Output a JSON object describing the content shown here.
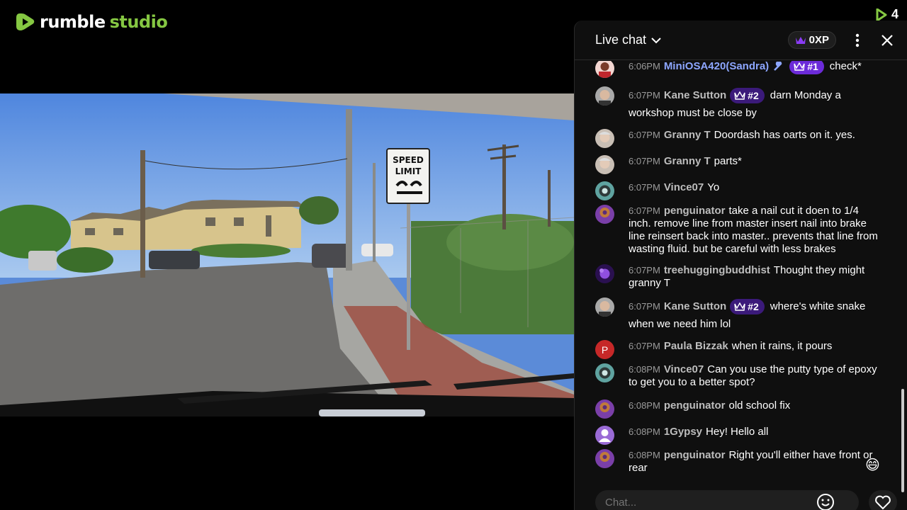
{
  "brand": {
    "name_part1": "rumble",
    "name_part2": "studio",
    "accent": "#85c742"
  },
  "viewers": {
    "count": "4"
  },
  "chat": {
    "title": "Live chat",
    "xp_label": "0XP",
    "input_placeholder": "Chat...",
    "messages": [
      {
        "time": "6:06PM",
        "user": "MiniOSA420(Sandra)",
        "badge": "#1",
        "text": "check*"
      },
      {
        "time": "6:07PM",
        "user": "Kane Sutton",
        "badge": "#2",
        "text": "darn Monday a workshop must be close by"
      },
      {
        "time": "6:07PM",
        "user": "Granny T",
        "text": "Doordash has oarts on it. yes."
      },
      {
        "time": "6:07PM",
        "user": "Granny T",
        "text": "parts*"
      },
      {
        "time": "6:07PM",
        "user": "Vince07",
        "text": "Yo"
      },
      {
        "time": "6:07PM",
        "user": "penguinator",
        "text": "take a nail cut it doen to 1/4 inch. remove line from master insert nail into brake line reinsert back into master.. prevents that line from wasting fluid. but be careful with less brakes"
      },
      {
        "time": "6:07PM",
        "user": "treehuggingbuddhist",
        "text": "Thought they might granny T"
      },
      {
        "time": "6:07PM",
        "user": "Kane Sutton",
        "badge": "#2",
        "text": "where's white snake when we need him lol"
      },
      {
        "time": "6:07PM",
        "user": "Paula Bizzak",
        "avatar_letter": "P",
        "text": "when it rains, it pours"
      },
      {
        "time": "6:08PM",
        "user": "Vince07",
        "text": "Can you use the putty type of epoxy to get you to a better spot?"
      },
      {
        "time": "6:08PM",
        "user": "penguinator",
        "text": "old school fix"
      },
      {
        "time": "6:08PM",
        "user": "1Gypsy",
        "text": "Hey! Hello all"
      },
      {
        "time": "6:08PM",
        "user": "penguinator",
        "text": "Right you'll either have front or rear"
      }
    ],
    "floating_emoji": "😄"
  },
  "video": {
    "sign_line1": "SPEED",
    "sign_line2": "LIMIT"
  }
}
